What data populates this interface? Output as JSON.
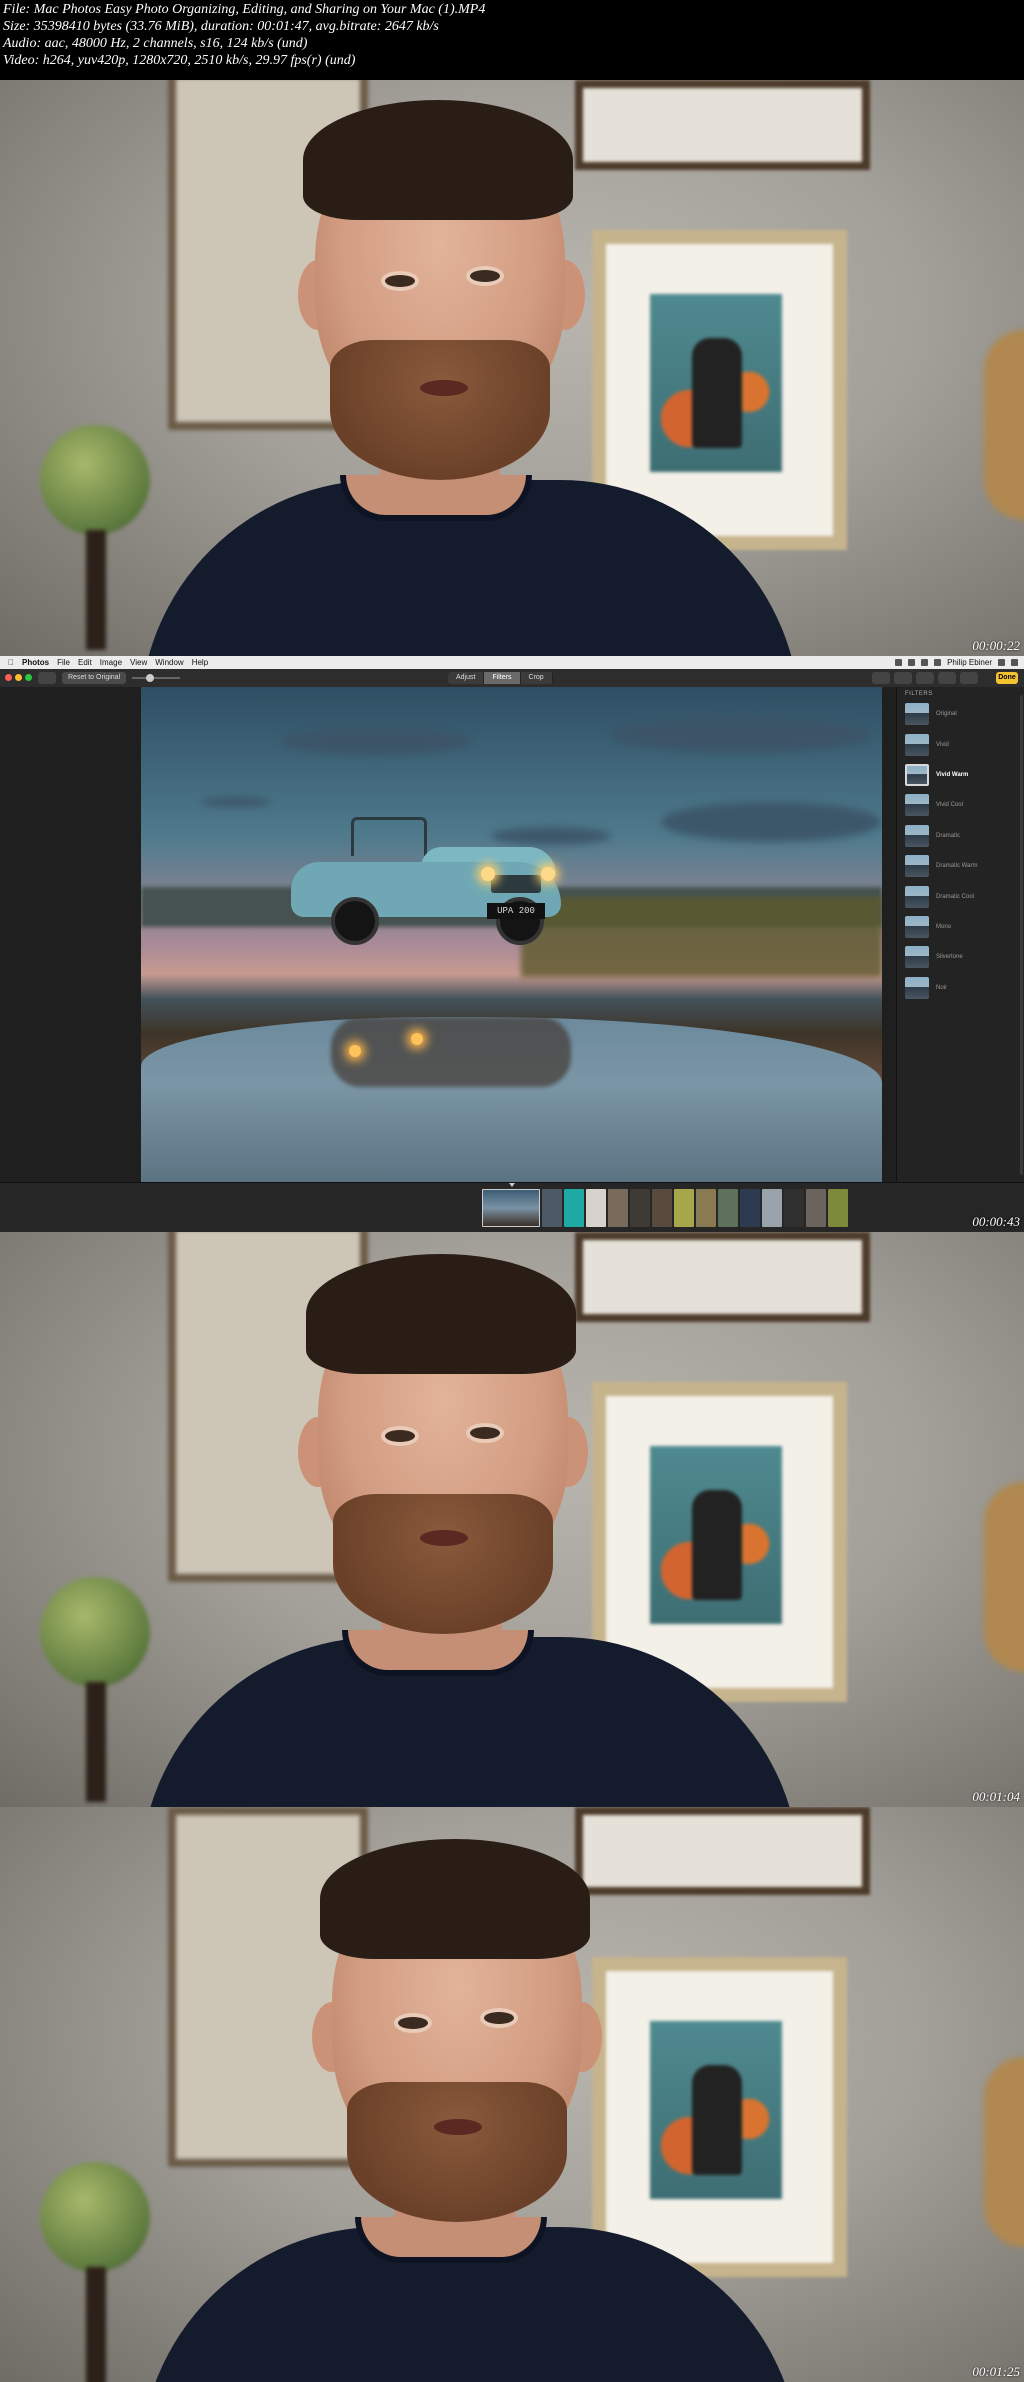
{
  "header": {
    "file": "File: Mac Photos Easy Photo Organizing, Editing, and Sharing on Your Mac (1).MP4",
    "size": "Size: 35398410 bytes (33.76 MiB), duration: 00:01:47, avg.bitrate: 2647 kb/s",
    "audio": "Audio: aac, 48000 Hz, 2 channels, s16, 124 kb/s (und)",
    "video": "Video: h264, yuv420p, 1280x720, 2510 kb/s, 29.97 fps(r) (und)"
  },
  "frames": {
    "f1": {
      "timestamp": "00:00:22"
    },
    "f2": {
      "timestamp": "00:00:43"
    },
    "f3": {
      "timestamp": "00:01:04"
    },
    "f4": {
      "timestamp": "00:01:25"
    }
  },
  "app": {
    "menu": [
      "Photos",
      "File",
      "Edit",
      "Image",
      "View",
      "Window",
      "Help"
    ],
    "user": "Philip Ebiner",
    "reset_label": "Reset to Original",
    "tabs": [
      {
        "label": "Adjust",
        "active": false
      },
      {
        "label": "Filters",
        "active": true
      },
      {
        "label": "Crop",
        "active": false
      }
    ],
    "done_label": "Done",
    "filters_title": "FILTERS",
    "filters": [
      {
        "label": "Original",
        "selected": false
      },
      {
        "label": "Vivid",
        "selected": false
      },
      {
        "label": "Vivid Warm",
        "selected": true
      },
      {
        "label": "Vivid Cool",
        "selected": false
      },
      {
        "label": "Dramatic",
        "selected": false
      },
      {
        "label": "Dramatic Warm",
        "selected": false
      },
      {
        "label": "Dramatic Cool",
        "selected": false
      },
      {
        "label": "Mono",
        "selected": false
      },
      {
        "label": "Silvertone",
        "selected": false
      },
      {
        "label": "Noir",
        "selected": false
      }
    ],
    "license_plate": "UPA 200",
    "accent_color": "#f3c430"
  }
}
